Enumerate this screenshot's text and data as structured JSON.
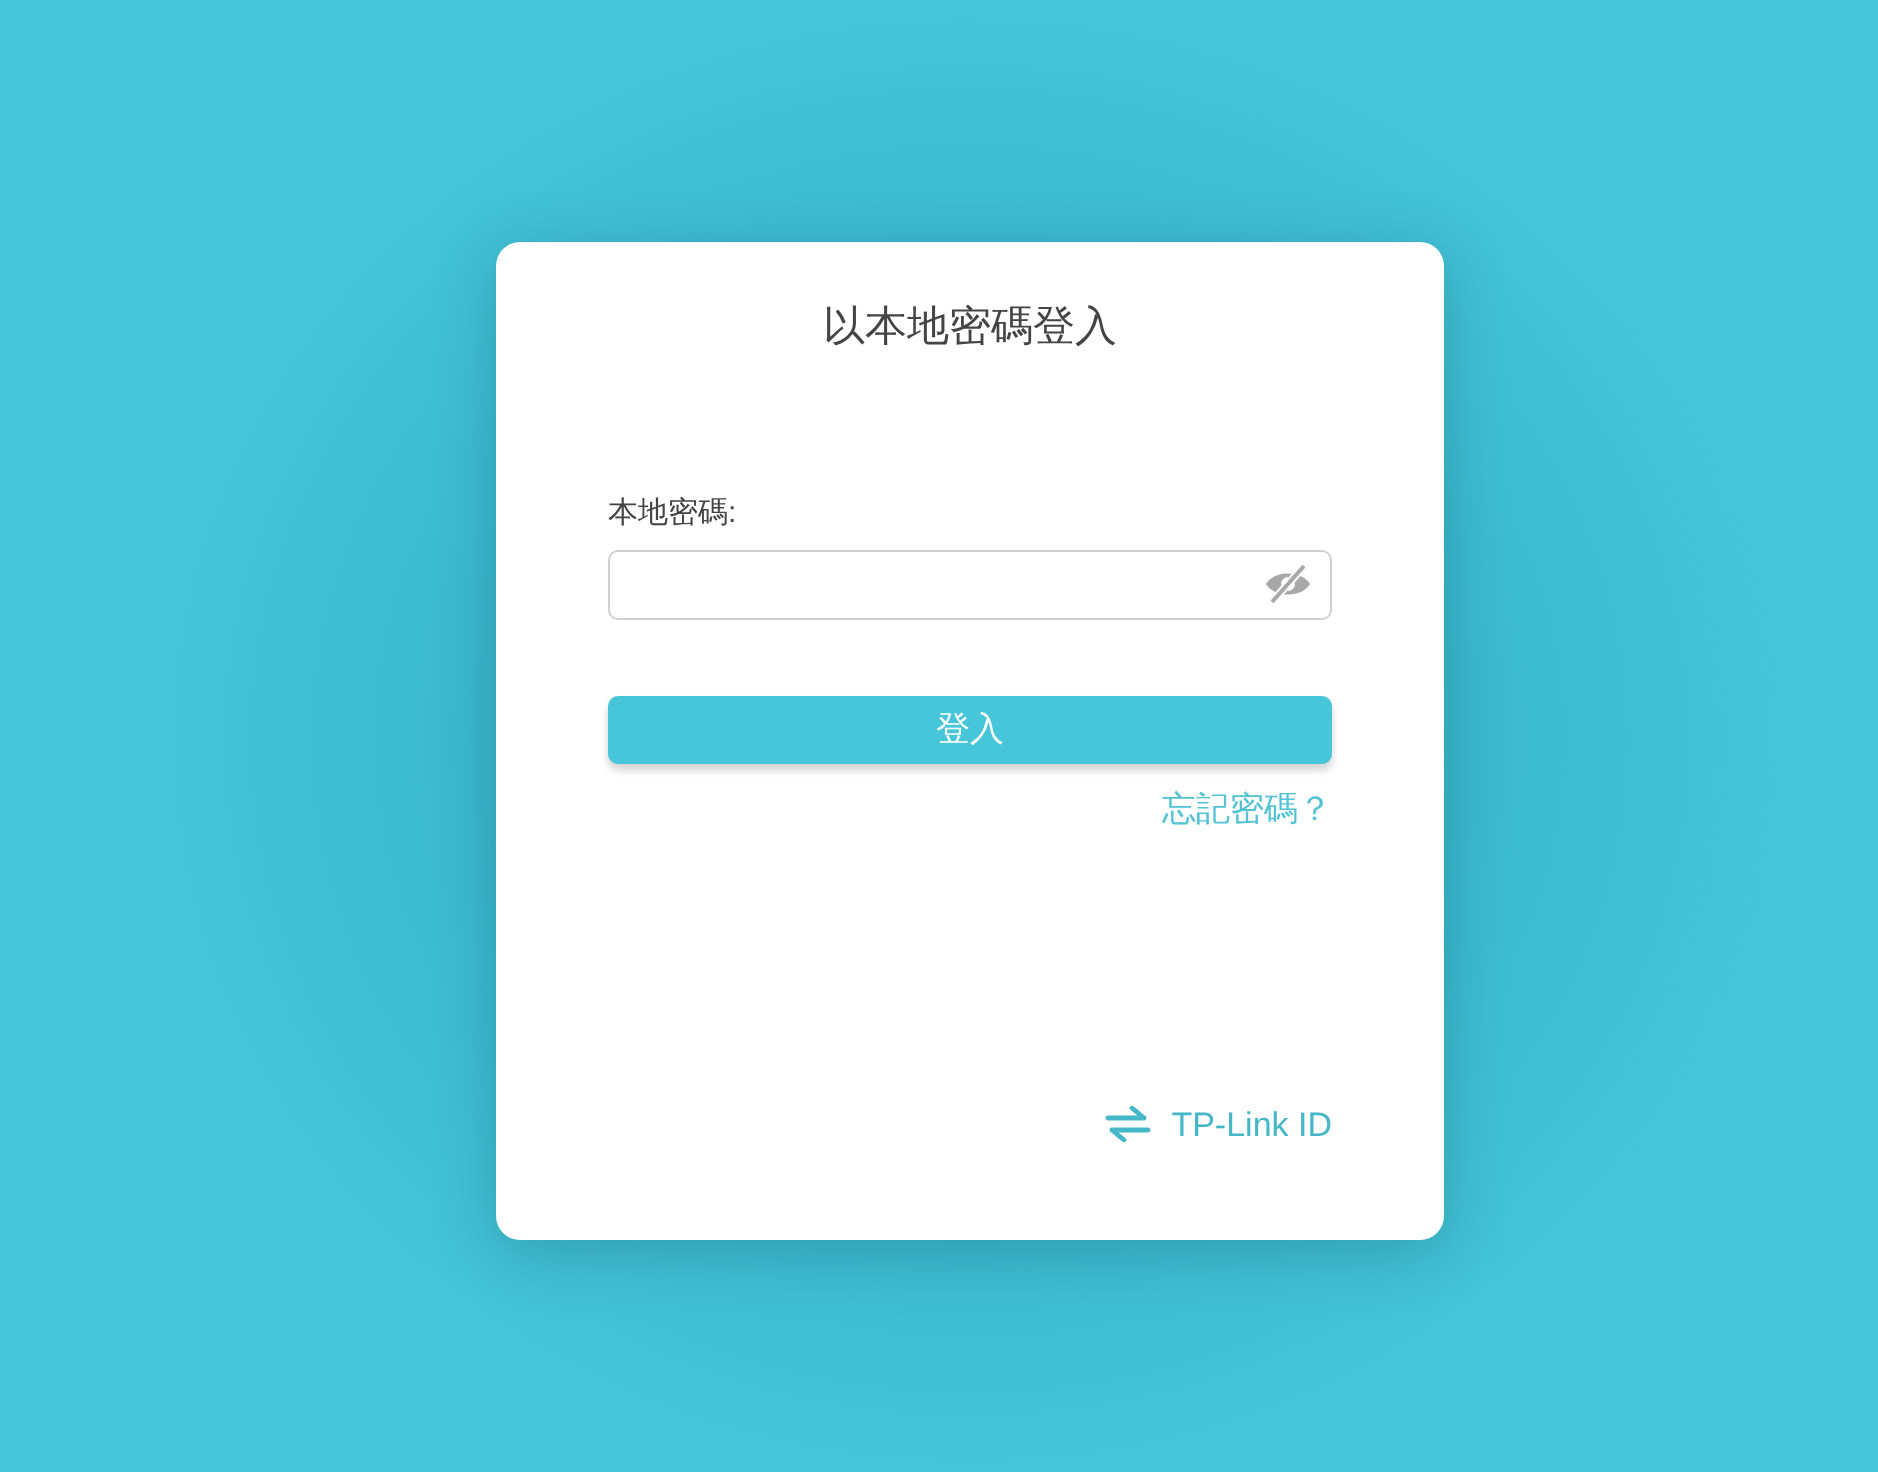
{
  "dialog": {
    "title": "以本地密碼登入"
  },
  "password_field": {
    "label": "本地密碼:",
    "password_visible": false
  },
  "login_button": {
    "label": "登入"
  },
  "forgot_link": {
    "label": "忘記密碼？"
  },
  "switch_link": {
    "label": "TP-Link ID"
  }
}
